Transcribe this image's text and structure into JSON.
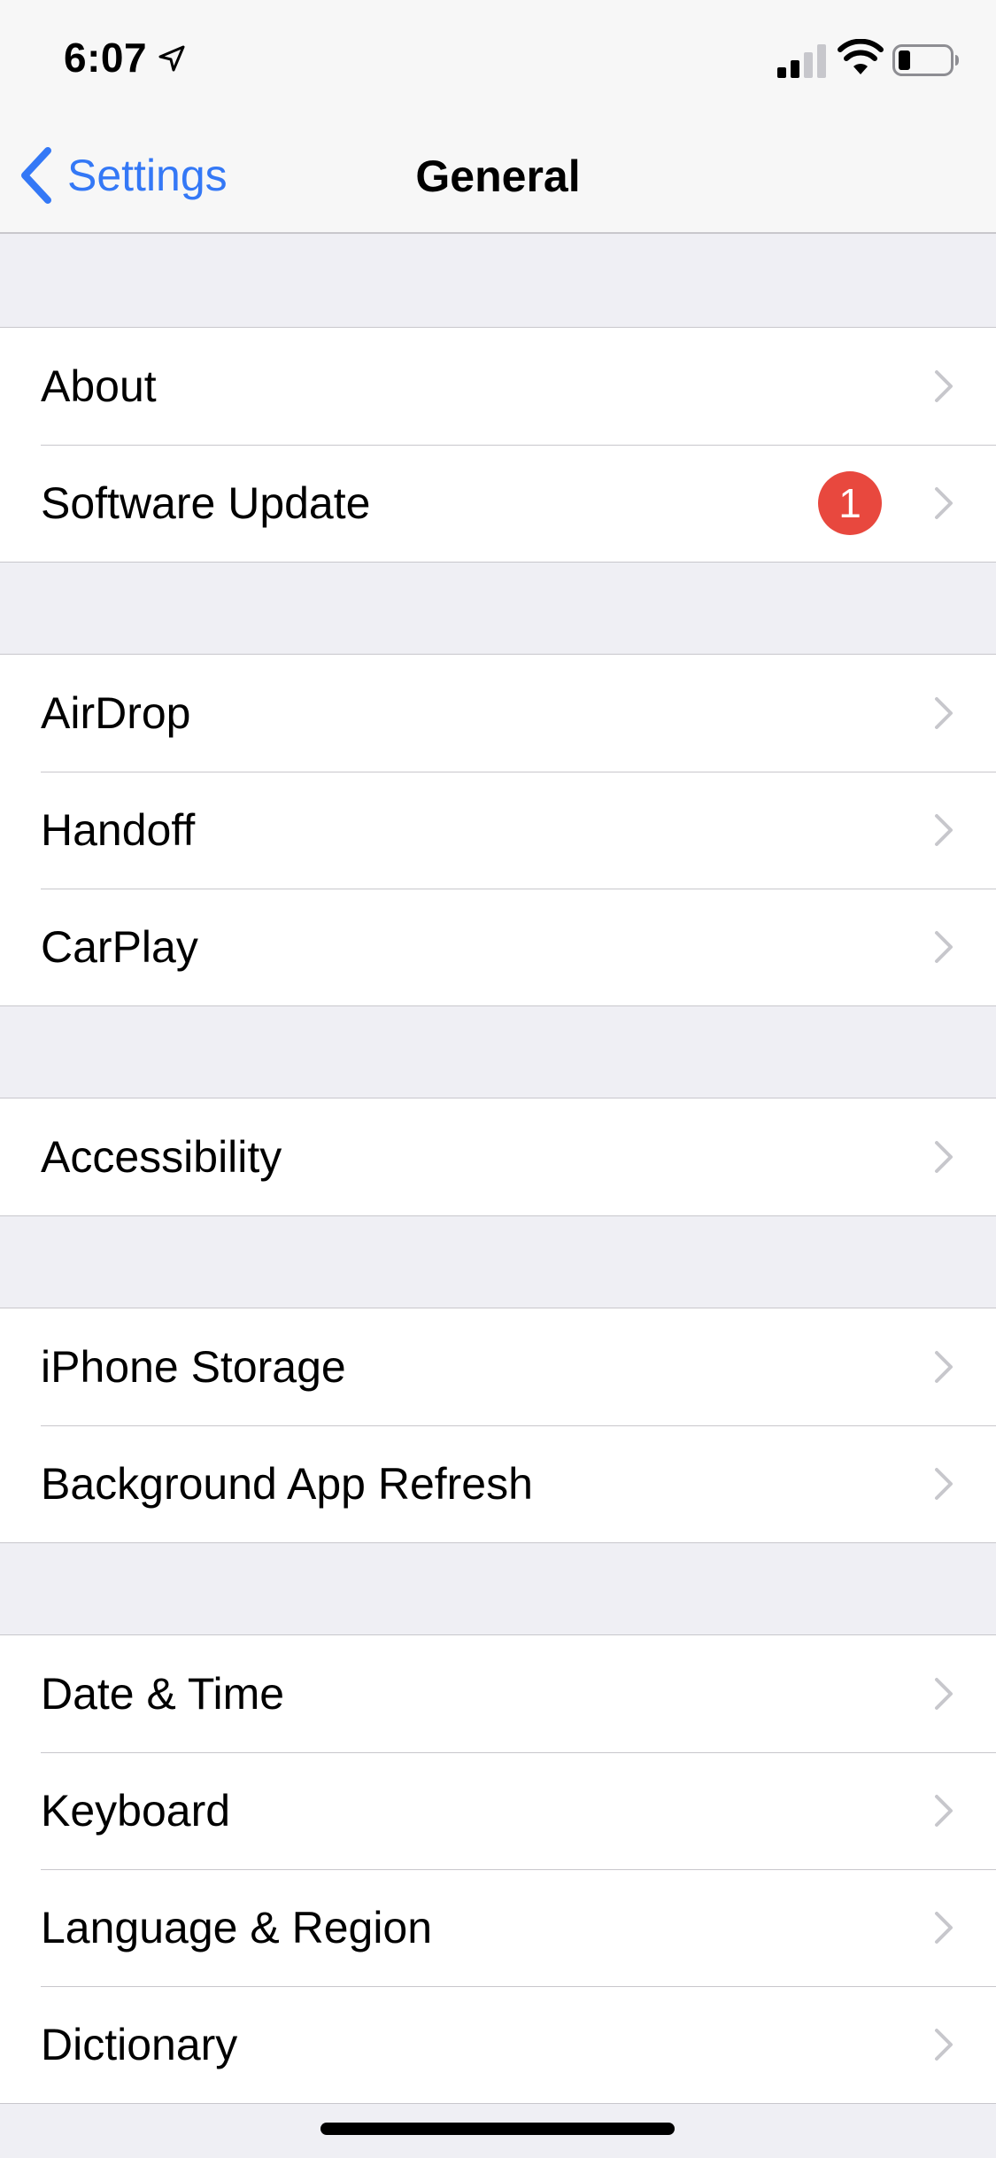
{
  "status_bar": {
    "time": "6:07",
    "icons": [
      "location-arrow-icon",
      "cellular-signal-icon",
      "wifi-icon",
      "battery-icon"
    ]
  },
  "nav": {
    "back_label": "Settings",
    "title": "General",
    "accent_color": "#3478f6"
  },
  "groups": [
    {
      "rows": [
        {
          "label": "About"
        },
        {
          "label": "Software Update",
          "badge": "1"
        }
      ]
    },
    {
      "rows": [
        {
          "label": "AirDrop"
        },
        {
          "label": "Handoff"
        },
        {
          "label": "CarPlay"
        }
      ]
    },
    {
      "rows": [
        {
          "label": "Accessibility"
        }
      ]
    },
    {
      "rows": [
        {
          "label": "iPhone Storage"
        },
        {
          "label": "Background App Refresh"
        }
      ]
    },
    {
      "rows": [
        {
          "label": "Date & Time"
        },
        {
          "label": "Keyboard"
        },
        {
          "label": "Language & Region"
        },
        {
          "label": "Dictionary"
        }
      ]
    }
  ],
  "colors": {
    "badge": "#e8483e",
    "background": "#efeff4",
    "chevron": "#c7c7cc"
  }
}
